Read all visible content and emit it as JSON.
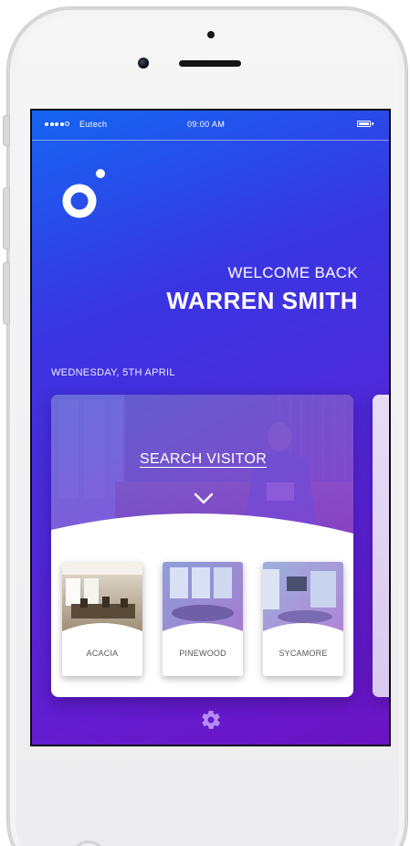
{
  "status_bar": {
    "carrier": "Eutech",
    "time": "09:00 AM",
    "signal_bars": 4,
    "signal_max": 5
  },
  "app": {
    "logo_icon": "app-logo-icon",
    "welcome_text": "WELCOME BACK",
    "user_name": "WARREN SMITH",
    "date": "WEDNESDAY, 5TH APRIL"
  },
  "search_card": {
    "action_label": "SEARCH VISITOR",
    "expand_icon": "chevron-down-icon"
  },
  "rooms": [
    {
      "label": "ACACIA"
    },
    {
      "label": "PINEWOOD"
    },
    {
      "label": "SYCAMORE"
    }
  ],
  "footer": {
    "settings_icon": "gear-icon"
  },
  "colors": {
    "gradient_start": "#1565f2",
    "gradient_end": "#6d14c4",
    "accent_gear": "#b58df0"
  }
}
